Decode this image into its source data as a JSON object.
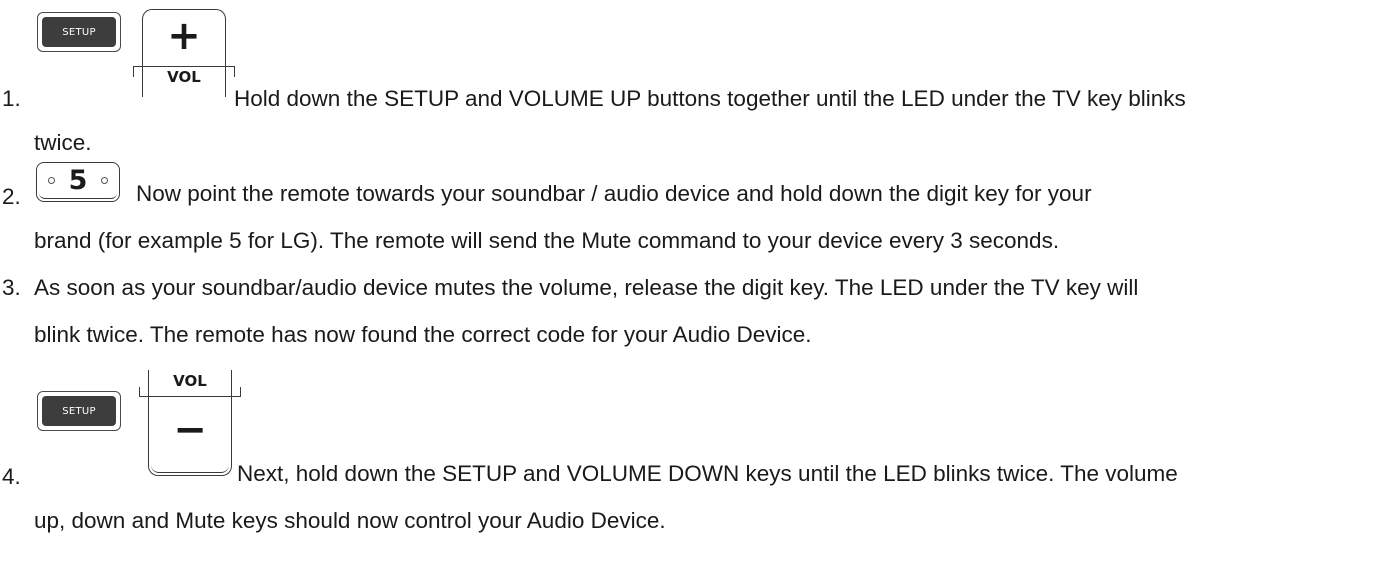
{
  "steps": [
    {
      "number": "1.",
      "line1": "Hold down the SETUP and VOLUME UP buttons together until the LED under the TV key blinks",
      "line2": "twice."
    },
    {
      "number": "2.",
      "line1": "Now point the remote towards your soundbar / audio device and hold down the digit key for your",
      "line2": "brand (for example 5 for LG). The remote will send the Mute command to your device every 3 seconds."
    },
    {
      "number": "3.",
      "line1": "As soon as your soundbar/audio device mutes the volume, release the digit key. The LED under the TV key will",
      "line2": "blink twice. The remote has now found the correct code for your Audio Device."
    },
    {
      "number": "4.",
      "line1": "Next, hold down the SETUP and VOLUME DOWN keys until the LED blinks twice. The volume",
      "line2": "up, down and Mute keys should now control your Audio Device."
    }
  ],
  "icons": {
    "setup_label": "SETUP",
    "vol_label": "VOL",
    "plus_sign": "+",
    "minus_sign": "−",
    "digit": "5"
  }
}
